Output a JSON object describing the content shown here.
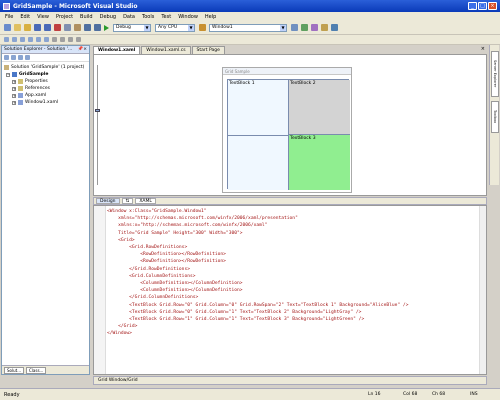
{
  "window": {
    "title": "GridSample - Microsoft Visual Studio"
  },
  "menu": [
    "File",
    "Edit",
    "View",
    "Project",
    "Build",
    "Debug",
    "Data",
    "Tools",
    "Test",
    "Window",
    "Help"
  ],
  "toolbar": {
    "config": "Debug",
    "platform": "Any CPU",
    "find": "Window1"
  },
  "solution_explorer": {
    "title": "Solution Explorer - Solution '...",
    "items": [
      {
        "label": "Solution 'GridSample' (1 project)",
        "icon_color": "#c9b27a"
      },
      {
        "label": "GridSample",
        "icon_color": "#4a78c8"
      },
      {
        "label": "Properties",
        "icon_color": "#d0c070"
      },
      {
        "label": "References",
        "icon_color": "#d0c070"
      },
      {
        "label": "App.xaml",
        "icon_color": "#88a0d8"
      },
      {
        "label": "Window1.xaml",
        "icon_color": "#88a0d8"
      }
    ],
    "tabs": [
      "Solut...",
      "Class..."
    ]
  },
  "doc_tabs": [
    "Window1.xaml",
    "Window1.xaml.cs",
    "Start Page"
  ],
  "designer": {
    "window_title": "Grid Sample",
    "cells": [
      "TextBlock 1",
      "TextBlock 2",
      "TextBlock 3"
    ],
    "colors": {
      "cell1": "#f0f8ff",
      "cell2": "#d3d3d3",
      "cell3": "#90ee90"
    }
  },
  "split_tabs": [
    "Design",
    "⇅",
    "XAML"
  ],
  "code_lines": [
    "<Window x:Class=\"GridSample.Window1\"",
    "    xmlns=\"http://schemas.microsoft.com/winfx/2006/xaml/presentation\"",
    "    xmlns:x=\"http://schemas.microsoft.com/winfx/2006/xaml\"",
    "    Title=\"Grid Sample\" Height=\"300\" Width=\"300\">",
    "    <Grid>",
    "        <Grid.RowDefinitions>",
    "            <RowDefinition></RowDefinition>",
    "            <RowDefinition></RowDefinition>",
    "        </Grid.RowDefinitions>",
    "        <Grid.ColumnDefinitions>",
    "            <ColumnDefinition></ColumnDefinition>",
    "            <ColumnDefinition></ColumnDefinition>",
    "        </Grid.ColumnDefinitions>",
    "        <TextBlock Grid.Row=\"0\" Grid.Column=\"0\" Grid.RowSpan=\"2\" Text=\"TextBlock 1\" Background=\"AliceBlue\" />",
    "        <TextBlock Grid.Row=\"0\" Grid.Column=\"1\" Text=\"TextBlock 2\" Background=\"LightGray\" />",
    "        <TextBlock Grid.Row=\"1\" Grid.Column=\"1\" Text=\"TextBlock 3\" Background=\"LightGreen\" />",
    "    </Grid>",
    "</Window>"
  ],
  "code_footer": "Grid Window/Grid",
  "right_tabs": [
    "Server Explorer",
    "Toolbox"
  ],
  "status": {
    "ready": "Ready",
    "ln": "Ln 16",
    "col": "Col 68",
    "ch": "Ch 68",
    "mode": "INS"
  }
}
